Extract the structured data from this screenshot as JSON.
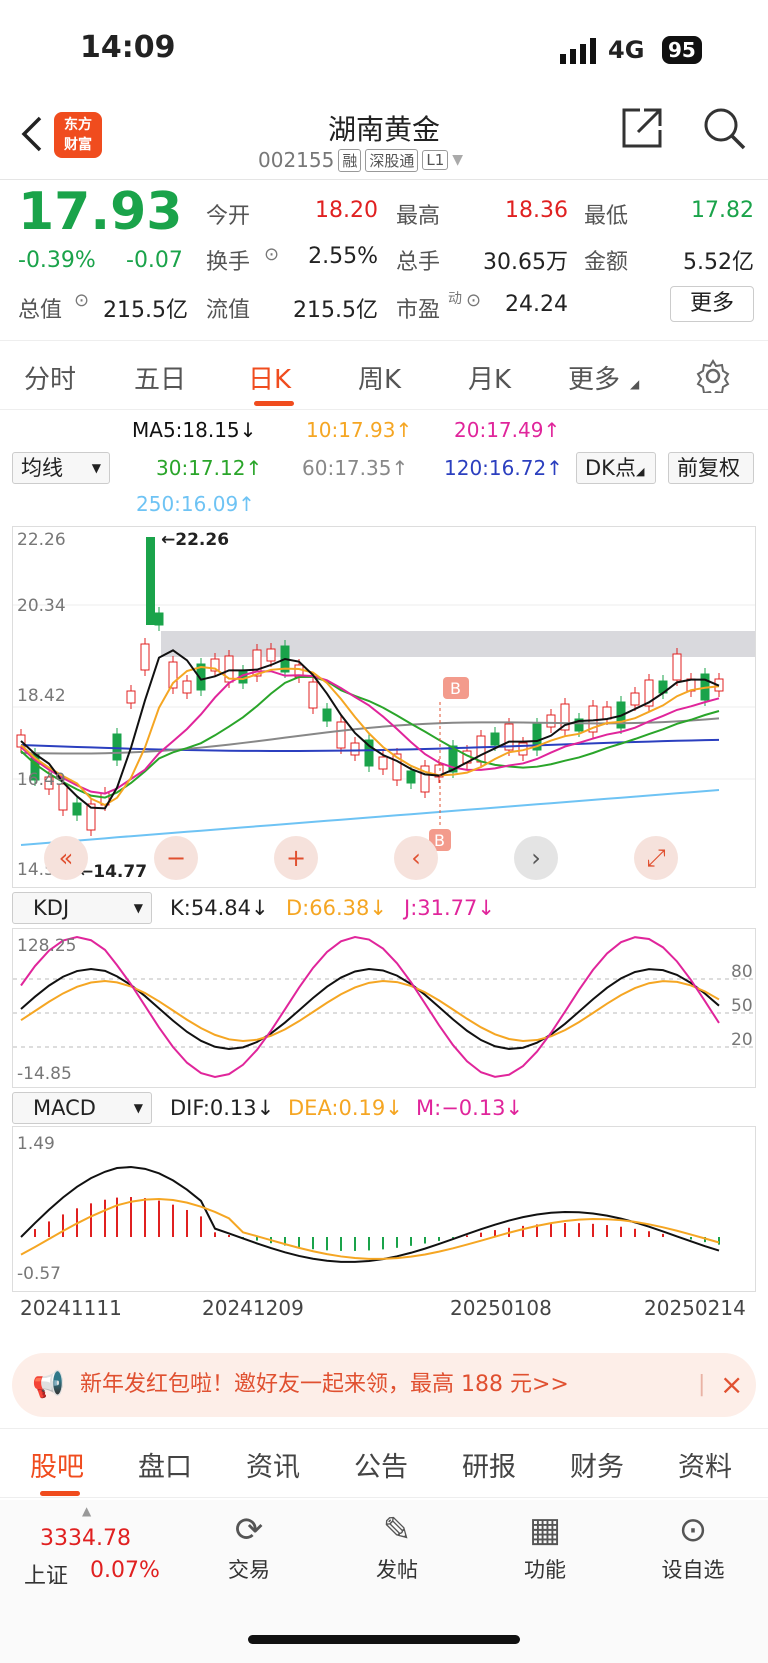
{
  "status": {
    "time": "14:09",
    "network": "4G",
    "battery": "95"
  },
  "header": {
    "back_icon": "chevron-left-icon",
    "logo_line1": "东方",
    "logo_line2": "财富",
    "title": "湖南黄金",
    "code": "002155",
    "tags": [
      "融",
      "深股通",
      "L1"
    ],
    "share_icon": "share-icon",
    "search_icon": "search-icon"
  },
  "quote": {
    "price": "17.93",
    "change_pct": "-0.39%",
    "change": "-0.07",
    "open_label": "今开",
    "open": "18.20",
    "high_label": "最高",
    "high": "18.36",
    "low_label": "最低",
    "low": "17.82",
    "turnover_label": "换手",
    "turnover": "2.55%",
    "volume_label": "总手",
    "volume": "30.65万",
    "amount_label": "金额",
    "amount": "5.52亿",
    "mktcap_label": "总值",
    "mktcap": "215.5亿",
    "float_label": "流值",
    "float": "215.5亿",
    "pe_label": "市盈",
    "pe_sup": "动",
    "pe": "24.24",
    "more": "更多"
  },
  "tabs": [
    "分时",
    "五日",
    "日K",
    "周K",
    "月K",
    "更多"
  ],
  "active_tab": 2,
  "ma": {
    "selector": "均线",
    "ma5": "MA5:18.15↓",
    "ma10": "10:17.93↑",
    "ma20": "20:17.49↑",
    "ma30": "30:17.12↑",
    "ma60": "60:17.35↑",
    "ma120": "120:16.72↑",
    "ma250": "250:16.09↑",
    "dk": "DK点",
    "fq": "前复权"
  },
  "colors": {
    "up": "#e02020",
    "down": "#1aa34a",
    "ma5": "#111111",
    "ma10": "#f5a623",
    "ma20": "#e0259b",
    "ma30": "#2aa52a",
    "ma60": "#888888",
    "ma120": "#2b3fbf",
    "ma250": "#6ec3f4",
    "accent": "#f04c1e"
  },
  "kline": {
    "y_top": "22.26",
    "y_2": "20.34",
    "y_3": "18.42",
    "y_4": "16.49",
    "y_bottom": "14.57",
    "max_label": "22.26",
    "min_label": "14.77"
  },
  "kdj": {
    "selector": "KDJ",
    "k": "K:54.84↓",
    "d": "D:66.38↓",
    "j": "J:31.77↓",
    "y_top": "128.25",
    "y_bottom": "-14.85",
    "l80": "80",
    "l50": "50",
    "l20": "20"
  },
  "macd": {
    "selector": "MACD",
    "dif": "DIF:0.13↓",
    "dea": "DEA:0.19↓",
    "m": "M:−0.13↓",
    "y_top": "1.49",
    "y_bottom": "-0.57"
  },
  "dates": [
    "20241111",
    "20241209",
    "20250108",
    "20250214"
  ],
  "banner": {
    "text": "新年发红包啦！邀好友一起来领，最高 188 元>>",
    "icon": "megaphone-icon",
    "close": "×"
  },
  "bottom_tabs": [
    "股吧",
    "盘口",
    "资讯",
    "公告",
    "研报",
    "财务",
    "资料"
  ],
  "dock": {
    "index_value": "3334.78",
    "index_name": "上证",
    "index_change": "0.07%",
    "trade": "交易",
    "post": "发帖",
    "func": "功能",
    "watch": "设自选"
  }
}
